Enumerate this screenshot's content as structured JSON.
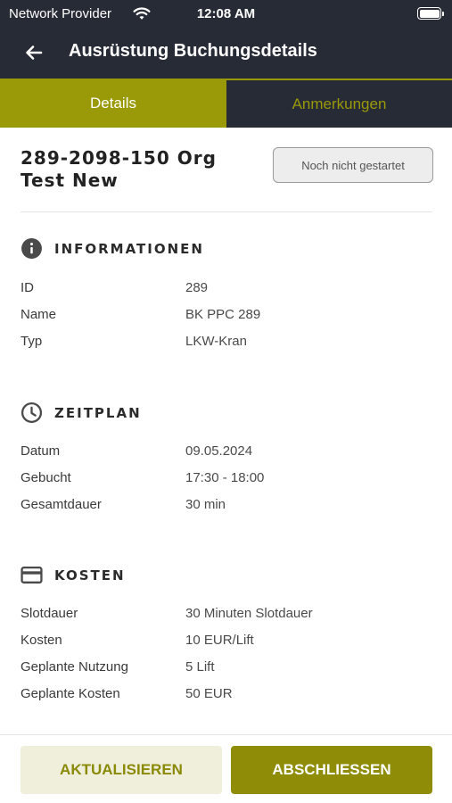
{
  "status_bar": {
    "carrier": "Network Provider",
    "time": "12:08 AM"
  },
  "nav": {
    "title": "Ausrüstung Buchungsdetails",
    "back_icon": "arrow-left-icon"
  },
  "tabs": [
    {
      "label": "Details",
      "active": true
    },
    {
      "label": "Anmerkungen",
      "active": false
    }
  ],
  "header": {
    "name_line1": "289-2098-150 Org",
    "name_line2": "Test New",
    "status": "Noch nicht gestartet"
  },
  "sections": {
    "info": {
      "title": "INFORMATIONEN",
      "icon": "info-icon",
      "rows": [
        {
          "label": "ID",
          "value": "289"
        },
        {
          "label": "Name",
          "value": "BK PPC 289"
        },
        {
          "label": "Typ",
          "value": "LKW-Kran"
        }
      ]
    },
    "schedule": {
      "title": "ZEITPLAN",
      "icon": "clock-icon",
      "rows": [
        {
          "label": "Datum",
          "value": "09.05.2024"
        },
        {
          "label": "Gebucht",
          "value": "17:30 - 18:00"
        },
        {
          "label": "Gesamtdauer",
          "value": "30 min"
        }
      ]
    },
    "costs": {
      "title": "KOSTEN",
      "icon": "credit-card-icon",
      "rows": [
        {
          "label": "Slotdauer",
          "value": "30 Minuten Slotdauer"
        },
        {
          "label": "Kosten",
          "value": "10 EUR/Lift"
        },
        {
          "label": "Geplante Nutzung",
          "value": "5 Lift"
        },
        {
          "label": "Geplante Kosten",
          "value": "50 EUR"
        }
      ]
    }
  },
  "footer": {
    "update_label": "AKTUALISIEREN",
    "complete_label": "ABSCHLIESSEN"
  },
  "colors": {
    "accent": "#9a9908",
    "dark": "#262b36"
  }
}
